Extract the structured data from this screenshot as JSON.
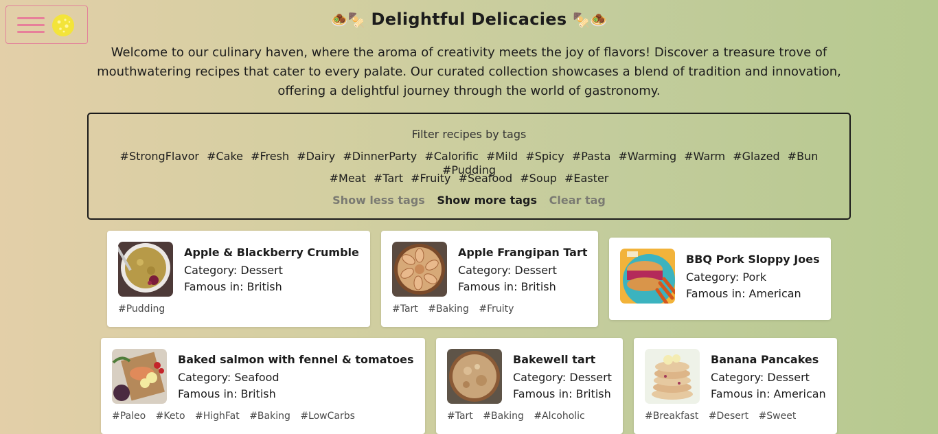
{
  "header": {
    "title": "Delightful Delicacies",
    "emoji_left": "🧆🍢",
    "emoji_right": "🍢🧆"
  },
  "intro": "Welcome to our culinary haven, where the aroma of creativity meets the joy of flavors! Discover a treasure trove of mouthwatering recipes that cater to every palate. Our curated collection showcases a blend of tradition and innovation, offering a delightful journey through the world of gastronomy.",
  "filter": {
    "label": "Filter recipes by tags",
    "tags_row1": [
      "#StrongFlavor",
      "#Cake",
      "#Fresh",
      "#Dairy",
      "#DinnerParty",
      "#Calorific",
      "#Mild",
      "#Spicy",
      "#Pasta",
      "#Warming",
      "#Warm",
      "#Glazed",
      "#Bun",
      "#Pudding"
    ],
    "tags_row2": [
      "#Meat",
      "#Tart",
      "#Fruity",
      "#Seafood",
      "#Soup",
      "#Easter"
    ],
    "show_less": "Show less tags",
    "show_more": "Show more tags",
    "clear": "Clear tag"
  },
  "recipes": [
    {
      "name": "Apple & Blackberry Crumble",
      "category": "Category: Dessert",
      "area": "Famous in: British",
      "tags": [
        "#Pudding"
      ]
    },
    {
      "name": "Apple Frangipan Tart",
      "category": "Category: Dessert",
      "area": "Famous in: British",
      "tags": [
        "#Tart",
        "#Baking",
        "#Fruity"
      ]
    },
    {
      "name": "BBQ Pork Sloppy Joes",
      "category": "Category: Pork",
      "area": "Famous in: American",
      "tags": []
    },
    {
      "name": "Baked salmon with fennel & tomatoes",
      "category": "Category: Seafood",
      "area": "Famous in: British",
      "tags": [
        "#Paleo",
        "#Keto",
        "#HighFat",
        "#Baking",
        "#LowCarbs"
      ]
    },
    {
      "name": "Bakewell tart",
      "category": "Category: Dessert",
      "area": "Famous in: British",
      "tags": [
        "#Tart",
        "#Baking",
        "#Alcoholic"
      ]
    },
    {
      "name": "Banana Pancakes",
      "category": "Category: Dessert",
      "area": "Famous in: American",
      "tags": [
        "#Breakfast",
        "#Desert",
        "#Sweet"
      ]
    }
  ],
  "colors": {
    "accent_pink": "#e77f9a",
    "moon_yellow": "#f3e43a",
    "text": "#1c1c1c"
  }
}
